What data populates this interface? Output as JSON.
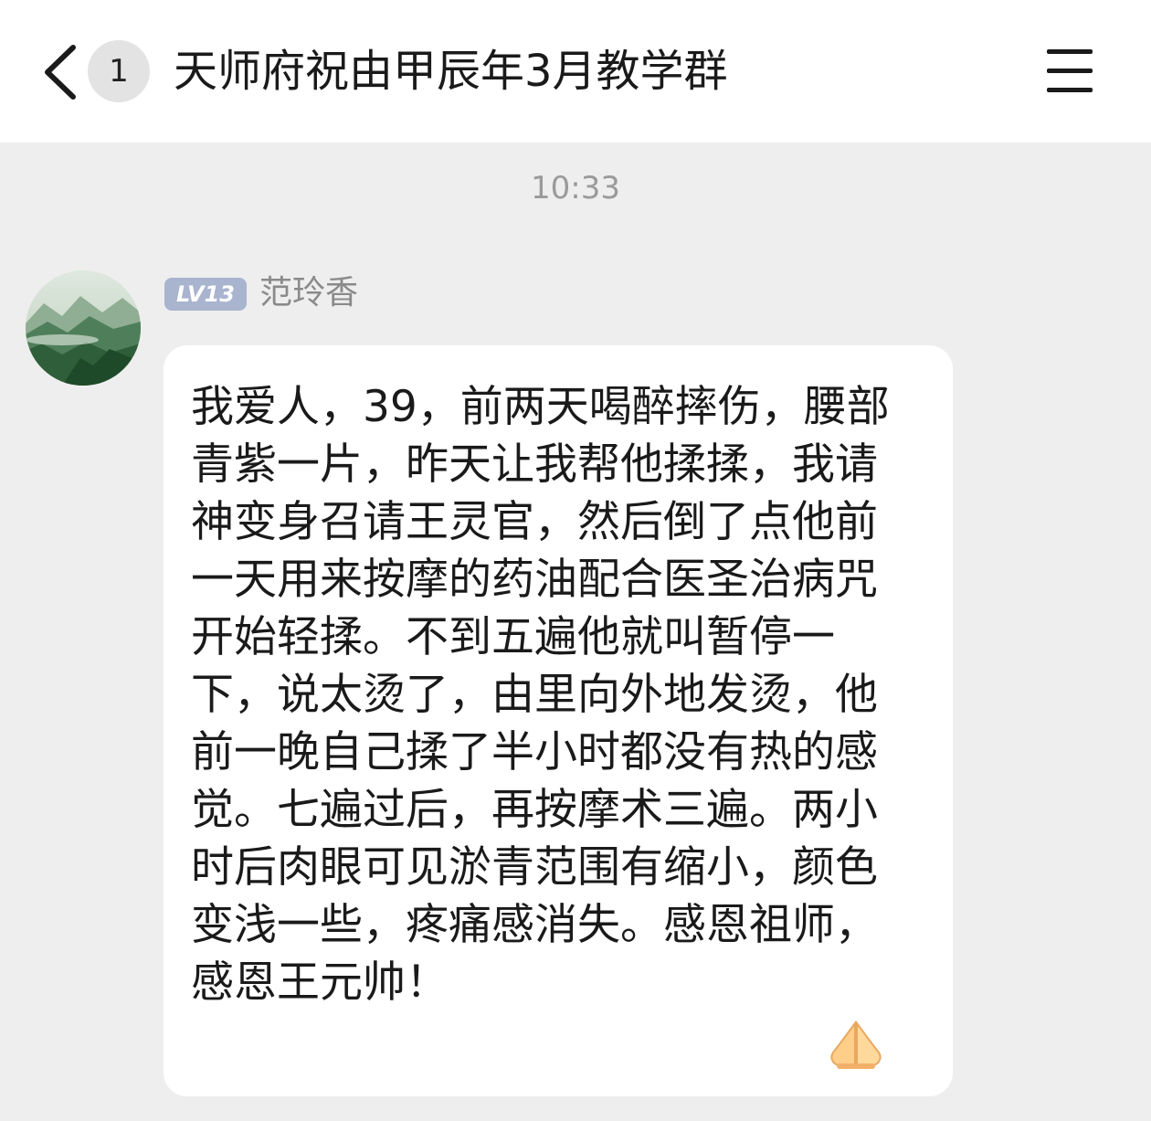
{
  "header": {
    "back_icon": "chevron-left-icon",
    "unread_count": "1",
    "title": "天师府祝由甲辰年3月教学群",
    "menu_icon": "hamburger-menu-icon"
  },
  "timestamp": "10:33",
  "message": {
    "avatar_icon": "mountain-landscape-avatar",
    "level_badge": "LV13",
    "sender": "范玲香",
    "text": "我爱人，39，前两天喝醉摔伤，腰部青紫一片，昨天让我帮他揉揉，我请神变身召请王灵官，然后倒了点他前一天用来按摩的药油配合医圣治病咒开始轻揉。不到五遍他就叫暂停一下，说太烫了，由里向外地发烫，他前一晚自己揉了半小时都没有热的感觉。七遍过后，再按摩术三遍。两小时后肉眼可见淤青范围有缩小，颜色变浅一些，疼痛感消失。感恩祖师，感恩王元帅！",
    "emoji_icon": "folded-hands-icon"
  },
  "colors": {
    "background": "#eeeeee",
    "header": "#ffffff",
    "bubble": "#ffffff",
    "level_badge": "#a9b4cf"
  }
}
